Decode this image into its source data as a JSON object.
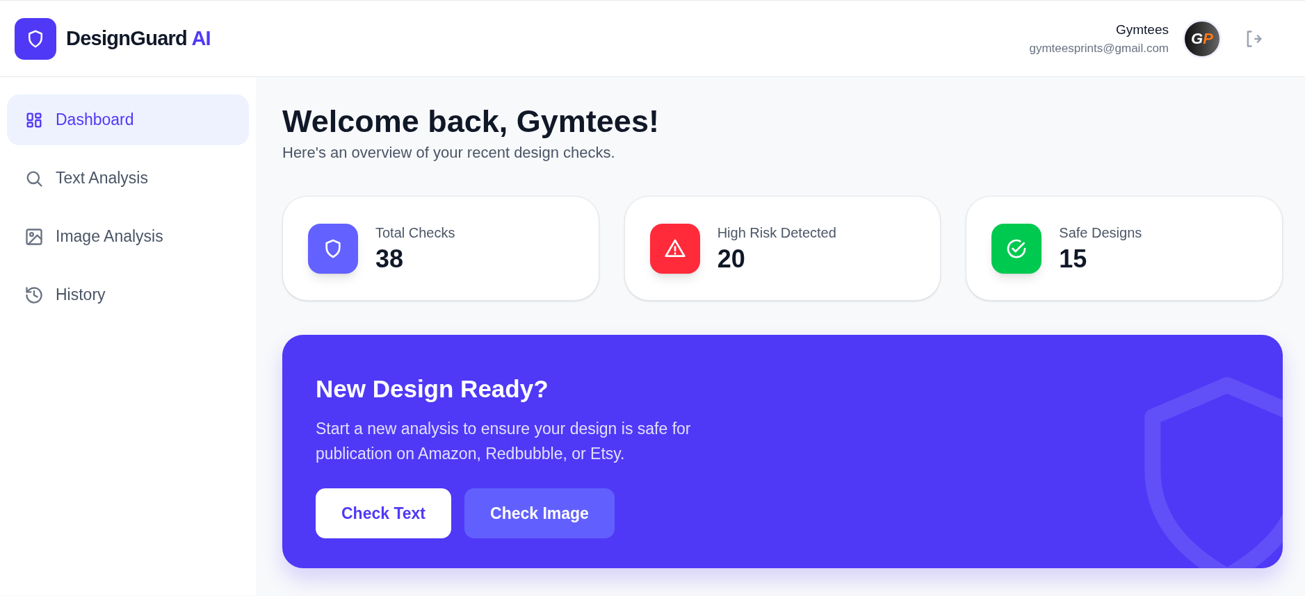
{
  "brand": {
    "name": "DesignGuard",
    "accent": "AI"
  },
  "user": {
    "name": "Gymtees",
    "email": "gymteesprints@gmail.com",
    "avatar_letters": [
      "G",
      "P"
    ]
  },
  "sidebar": {
    "items": [
      {
        "label": "Dashboard",
        "kind": "grid",
        "selected": true
      },
      {
        "label": "Text Analysis",
        "kind": "search",
        "selected": false
      },
      {
        "label": "Image Analysis",
        "kind": "image",
        "selected": false
      },
      {
        "label": "History",
        "kind": "history",
        "selected": false
      }
    ]
  },
  "heading": {
    "title": "Welcome back, Gymtees!",
    "subtitle": "Here's an overview of your recent design checks."
  },
  "stats": [
    {
      "label": "Total Checks",
      "value": "38",
      "kind": "shield",
      "color": "#6361ff"
    },
    {
      "label": "High Risk Detected",
      "value": "20",
      "kind": "alert",
      "color": "#ff2a3a"
    },
    {
      "label": "Safe Designs",
      "value": "15",
      "kind": "check",
      "color": "#00c950"
    }
  ],
  "banner": {
    "title": "New Design Ready?",
    "text": "Start a new analysis to ensure your design is safe for publication on Amazon, Redbubble, or Etsy.",
    "buttons": [
      {
        "label": "Check Text",
        "kind": "primary"
      },
      {
        "label": "Check Image",
        "kind": "secondary"
      }
    ]
  }
}
